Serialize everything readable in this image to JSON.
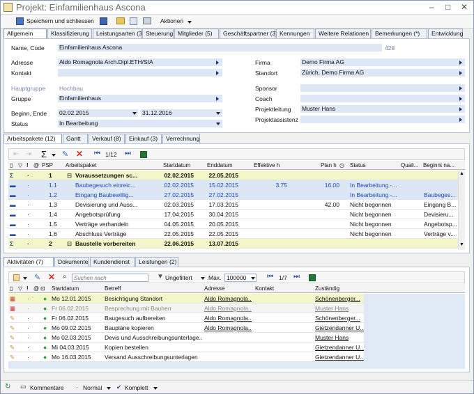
{
  "window": {
    "title": "Projekt: Einfamilienhaus Ascona",
    "min": "–",
    "max": "□",
    "close": "✕"
  },
  "toolbar": {
    "save_close": "Speichern und schliessen",
    "actions": "Aktionen"
  },
  "top_tabs": [
    "Allgemein",
    "Klassifizierung",
    "Leistungsarten (3)",
    "Steuerung",
    "Mitglieder (5)",
    "Geschäftspartner (3)",
    "Kennungen",
    "Weitere Relationen",
    "Bemerkungen (*)",
    "Entwicklung"
  ],
  "form": {
    "name_label": "Name, Code",
    "name": "Einfamilienhaus Ascona",
    "code": "428",
    "adresse_label": "Adresse",
    "adresse": "Aldo Romagnola Arch.Dipl.ETH/SIA",
    "kontakt_label": "Kontakt",
    "kontakt": "",
    "hauptgruppe_label": "Hauptgruppe",
    "hauptgruppe": "Hochbau",
    "gruppe_label": "Gruppe",
    "gruppe": "Einfamilienhaus",
    "beginn_label": "Beginn, Ende",
    "beginn": "02.02.2015",
    "ende": "31.12.2016",
    "status_label": "Status",
    "status": "In Bearbeitung",
    "firma_label": "Firma",
    "firma": "Demo Firma AG",
    "standort_label": "Standort",
    "standort": "Zürich, Demo Firma AG",
    "sponsor_label": "Sponsor",
    "sponsor": "",
    "coach_label": "Coach",
    "coach": "",
    "projektleitung_label": "Projektleitung",
    "projektleitung": "Muster Hans",
    "projektassistenz_label": "Projektassistenz",
    "projektassistenz": ""
  },
  "mid_tabs": [
    "Arbeitspakete (12)",
    "Gantt",
    "Verkauf (8)",
    "Einkauf (3)",
    "Verrechnung"
  ],
  "ap_toolbar": {
    "page": "1/12"
  },
  "ap_headers": {
    "psp": "PSP",
    "arbeitspaket": "Arbeitspaket",
    "start": "Startdatum",
    "end": "Enddatum",
    "effektiv": "Effektive h",
    "plan": "Plan h",
    "status": "Status",
    "quali": "Quali...",
    "beginnt": "Beginnt na..."
  },
  "ap_rows": [
    {
      "psp": "1",
      "name": "Voraussetzungen sc...",
      "start": "02.02.2015",
      "end": "22.05.2015",
      "eff": "",
      "plan": "",
      "status": "",
      "beginnt": "",
      "kind": "group"
    },
    {
      "psp": "1.1",
      "name": "Baubegesuch einreic...",
      "start": "02.02.2015",
      "end": "15.02.2015",
      "eff": "3.75",
      "plan": "16.00",
      "status": "In Bearbeitung -...",
      "beginnt": "",
      "kind": "blue"
    },
    {
      "psp": "1.2",
      "name": "Eingang Baubewillig...",
      "start": "27.02.2015",
      "end": "27.02.2015",
      "eff": "",
      "plan": "",
      "status": "In Bearbeitung -...",
      "beginnt": "Baubeges...",
      "kind": "blue"
    },
    {
      "psp": "1.3",
      "name": "Devisierung und Auss...",
      "start": "02.03.2015",
      "end": "17.03.2015",
      "eff": "",
      "plan": "42.00",
      "status": "Nicht begonnen",
      "beginnt": "Eingang B...",
      "kind": "plain"
    },
    {
      "psp": "1.4",
      "name": "Angebotsprüfung",
      "start": "17.04.2015",
      "end": "30.04.2015",
      "eff": "",
      "plan": "",
      "status": "Nicht begonnen",
      "beginnt": "Devisieru...",
      "kind": "plain"
    },
    {
      "psp": "1.5",
      "name": "Verträge verhandeln",
      "start": "04.05.2015",
      "end": "20.05.2015",
      "eff": "",
      "plan": "",
      "status": "Nicht begonnen",
      "beginnt": "Angebotsp...",
      "kind": "plain"
    },
    {
      "psp": "1.6",
      "name": "Abschluss Verträge",
      "start": "22.05.2015",
      "end": "22.05.2015",
      "eff": "",
      "plan": "",
      "status": "Nicht begonnen",
      "beginnt": "Verträge v...",
      "kind": "plain"
    },
    {
      "psp": "2",
      "name": "Baustelle vorbereiten",
      "start": "22.06.2015",
      "end": "13.07.2015",
      "eff": "",
      "plan": "",
      "status": "",
      "beginnt": "",
      "kind": "group"
    }
  ],
  "bottom_tabs": [
    "Aktivitäten (7)",
    "Dokumente",
    "Kundendienst",
    "Leistungen (2)"
  ],
  "act_toolbar": {
    "search_placeholder": "Suchen nach",
    "filter": "Ungefiltert",
    "max_label": "Max.",
    "max": "100000",
    "page": "1/7"
  },
  "act_headers": {
    "start": "Startdatum",
    "betreff": "Betreff",
    "adresse": "Adresse",
    "kontakt": "Kontakt",
    "zustaendig": "Zuständig"
  },
  "act_rows": [
    {
      "date": "Mo 12.01.2015",
      "betreff": "Besichtigung Standort",
      "adresse": "Aldo Romagnola...",
      "kontakt": "",
      "zust": "Schönenberger...",
      "kind": "yellow"
    },
    {
      "date": "Fr 06.02.2015",
      "betreff": "Besprechung mit Bauherr",
      "adresse": "Aldo Romagnola...",
      "kontakt": "",
      "zust": "Muster Hans",
      "kind": "grey"
    },
    {
      "date": "Fr 06.02.2015",
      "betreff": "Baugesuch aufbereiten",
      "adresse": "Aldo Romagnola...",
      "kontakt": "",
      "zust": "Schönenberger...",
      "kind": "plain"
    },
    {
      "date": "Mo 09.02.2015",
      "betreff": "Baupläne kopieren",
      "adresse": "Aldo Romagnola...",
      "kontakt": "",
      "zust": "Gietzendanner U...",
      "kind": "plain"
    },
    {
      "date": "Mo 02.03.2015",
      "betreff": "Devis und Ausschreibungsunterlage...",
      "adresse": "",
      "kontakt": "",
      "zust": "Muster Hans",
      "kind": "plain"
    },
    {
      "date": "Mi 04.03.2015",
      "betreff": "Kopien bestellen",
      "adresse": "",
      "kontakt": "",
      "zust": "Gietzendanner U...",
      "kind": "plain"
    },
    {
      "date": "Mo 16.03.2015",
      "betreff": "Versand Ausschreibungsunterlagen",
      "adresse": "",
      "kontakt": "",
      "zust": "Gietzendanner U...",
      "kind": "plain"
    }
  ],
  "statusbar": {
    "kommentare": "Kommentare",
    "normal": "Normal",
    "komplett": "Komplett"
  }
}
